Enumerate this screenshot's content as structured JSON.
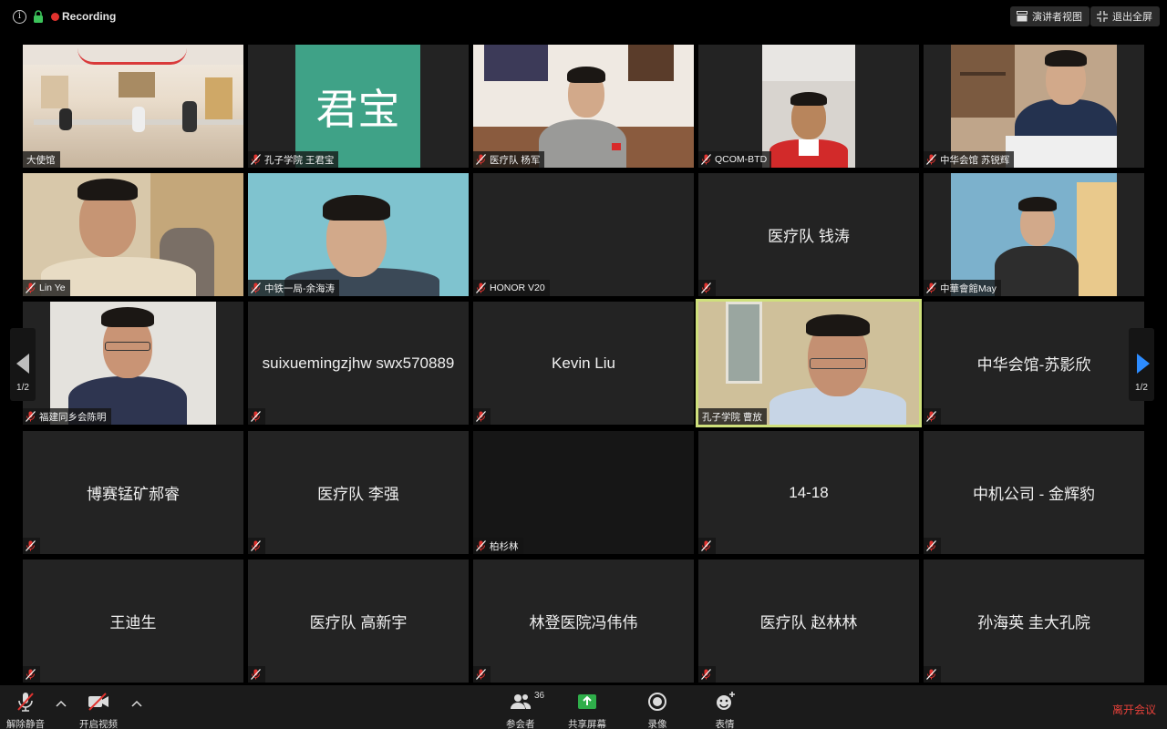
{
  "topbar": {
    "recording_label": "Recording",
    "speaker_view_label": "演讲者视图",
    "exit_fullscreen_label": "退出全屏",
    "recording_color": "#e0322e"
  },
  "tiles": {
    "t0": {
      "name": "大使馆"
    },
    "t1": {
      "name": "孔子学院 王君宝",
      "avatar_text": "君宝",
      "avatar_color": "#3fa287"
    },
    "t2": {
      "name": "医疗队 杨军"
    },
    "t3": {
      "name": "QCOM-BTD"
    },
    "t4": {
      "name": "中华会馆 苏锐辉"
    },
    "t5": {
      "name": "Lin Ye"
    },
    "t6": {
      "name": "中铁一局-余海涛"
    },
    "t7": {
      "name": "HONOR V20"
    },
    "t8": {
      "name": "医疗队 钱涛"
    },
    "t9": {
      "name": "中華會館May"
    },
    "t10": {
      "name": "福建同乡会陈明"
    },
    "t11": {
      "name": "suixuemingzjhw swx570889"
    },
    "t12": {
      "name": "Kevin Liu"
    },
    "t13": {
      "name": "孔子学院  曹放"
    },
    "t14": {
      "name": "中华会馆-苏影欣"
    },
    "t15": {
      "name": "博赛锰矿郝睿"
    },
    "t16": {
      "name": "医疗队 李强"
    },
    "t17": {
      "name": "柏杉林"
    },
    "t18": {
      "name": "14-18"
    },
    "t19": {
      "name": "中机公司 - 金辉豹"
    },
    "t20": {
      "name": "王迪生"
    },
    "t21": {
      "name": "医疗队 高新宇"
    },
    "t22": {
      "name": "林登医院冯伟伟"
    },
    "t23": {
      "name": "医疗队 赵林林"
    },
    "t24": {
      "name": "孙海英 圭大孔院"
    }
  },
  "pager": {
    "left_page": "1/2",
    "right_page": "1/2",
    "active_arrow_color": "#2d8cff"
  },
  "toolbar": {
    "unmute_label": "解除静音",
    "start_video_label": "开启视频",
    "participants_label": "参会者",
    "participants_count": "36",
    "share_label": "共享屏幕",
    "record_label": "录像",
    "reactions_label": "表情",
    "leave_label": "离开会议",
    "share_color": "#2fae4a",
    "leave_color": "#e8413a"
  }
}
